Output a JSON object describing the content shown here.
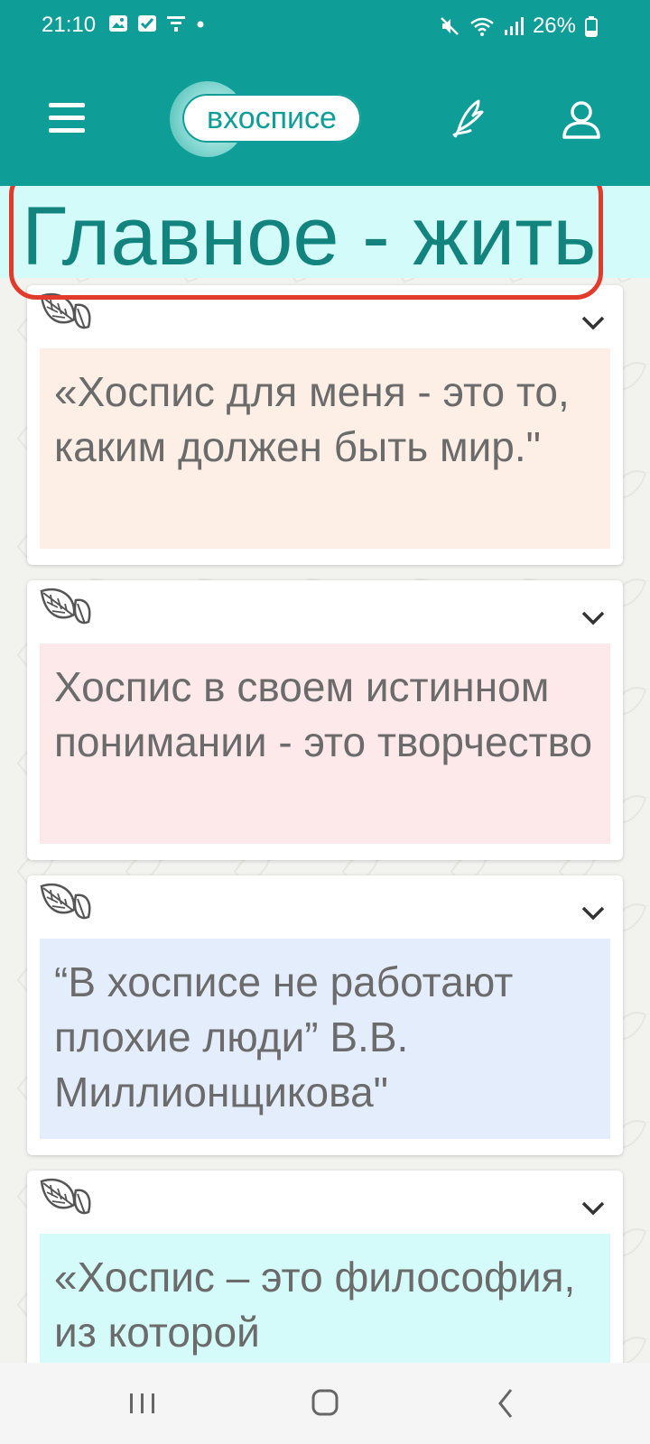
{
  "status_bar": {
    "time": "21:10",
    "battery": "26%",
    "left_icons": [
      "image-icon",
      "checkbox-icon",
      "filter-icon",
      "dot-icon"
    ],
    "right_icons": [
      "mute-icon",
      "wifi-icon",
      "signal-icon",
      "battery-icon"
    ]
  },
  "app_bar": {
    "logo_text": "вхосписе",
    "icons": [
      "menu-icon",
      "pen-icon",
      "user-icon"
    ],
    "color": "#0f9e97"
  },
  "banner": {
    "title": "Главное - жить",
    "background": "#d2fbfa",
    "highlight_color": "#e23b2b"
  },
  "cards": [
    {
      "text": "«Хоспис для меня - это то, каким должен быть мир.\"",
      "background": "#fdefe6"
    },
    {
      "text": "Хоспис в своем истинном понимании - это творчество",
      "background": "#fde9ea"
    },
    {
      "text": "“В хосписе не работают плохие люди” В.В. Миллионщикова\"",
      "background": "#e4edfc"
    },
    {
      "text": "«Хоспис – это философия, из которой",
      "background": "#d4fbfa"
    }
  ],
  "nav_bar": {
    "items": [
      "recents-icon",
      "home-icon",
      "back-icon"
    ]
  }
}
